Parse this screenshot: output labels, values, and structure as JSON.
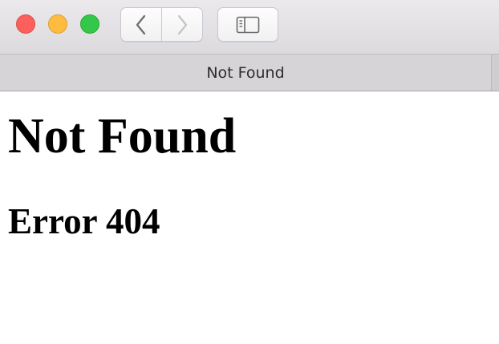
{
  "window": {
    "buttons": {
      "close": "close",
      "minimize": "minimize",
      "zoom": "zoom"
    },
    "colors": {
      "close": "#fc605c",
      "minimize": "#fdbc40",
      "zoom": "#34c84a"
    }
  },
  "toolbar": {
    "back_icon": "chevron-left-icon",
    "forward_icon": "chevron-right-icon",
    "sidebar_icon": "sidebar-icon"
  },
  "tab": {
    "title": "Not Found"
  },
  "page": {
    "heading": "Not Found",
    "subheading": "Error 404"
  }
}
